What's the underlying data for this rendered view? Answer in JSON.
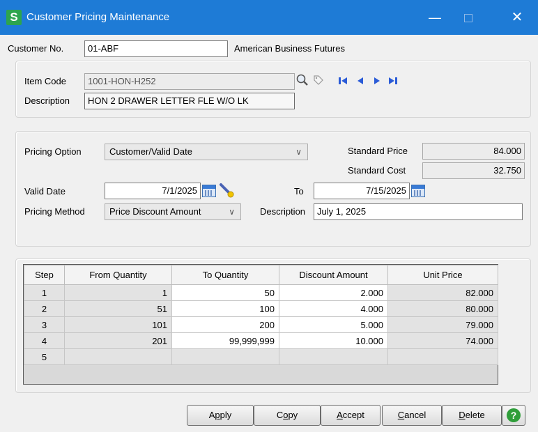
{
  "window": {
    "app_icon": "S",
    "title": "Customer Pricing Maintenance",
    "minimize": "—",
    "close": "✕"
  },
  "customer": {
    "label": "Customer No.",
    "number": "01-ABF",
    "name": "American Business Futures"
  },
  "item": {
    "code_label": "Item Code",
    "code": "1001-HON-H252",
    "description_label": "Description",
    "description": "HON 2 DRAWER LETTER FLE W/O LK"
  },
  "pricing": {
    "option_label": "Pricing Option",
    "option_value": "Customer/Valid Date",
    "standard_price_label": "Standard Price",
    "standard_price": "84.000",
    "standard_cost_label": "Standard Cost",
    "standard_cost": "32.750",
    "valid_date_label": "Valid Date",
    "valid_date": "7/1/2025",
    "to_label": "To",
    "to_date": "7/15/2025",
    "method_label": "Pricing Method",
    "method_value": "Price Discount Amount",
    "description_label": "Description",
    "description": "July 1, 2025"
  },
  "grid": {
    "headers": [
      "Step",
      "From Quantity",
      "To Quantity",
      "Discount Amount",
      "Unit Price"
    ],
    "rows": [
      {
        "step": "1",
        "from": "1",
        "to": "50",
        "discount": "2.000",
        "unit": "82.000"
      },
      {
        "step": "2",
        "from": "51",
        "to": "100",
        "discount": "4.000",
        "unit": "80.000"
      },
      {
        "step": "3",
        "from": "101",
        "to": "200",
        "discount": "5.000",
        "unit": "79.000"
      },
      {
        "step": "4",
        "from": "201",
        "to": "99,999,999",
        "discount": "10.000",
        "unit": "74.000"
      },
      {
        "step": "5",
        "from": "",
        "to": "",
        "discount": "",
        "unit": ""
      }
    ]
  },
  "buttons": {
    "apply": {
      "pre": "A",
      "u": "p",
      "post": "ply"
    },
    "copy": {
      "pre": "C",
      "u": "o",
      "post": "py"
    },
    "accept": {
      "pre": "",
      "u": "A",
      "post": "ccept"
    },
    "cancel": {
      "pre": "",
      "u": "C",
      "post": "ancel"
    },
    "delete": {
      "pre": "",
      "u": "D",
      "post": "elete"
    },
    "help": "?"
  },
  "icons": {
    "lookup": "magnifier-icon",
    "memo": "tag-icon",
    "first": "first-record-icon",
    "prev": "previous-record-icon",
    "next": "next-record-icon",
    "last": "last-record-icon",
    "calendar": "calendar-icon",
    "wand": "wand-icon"
  }
}
